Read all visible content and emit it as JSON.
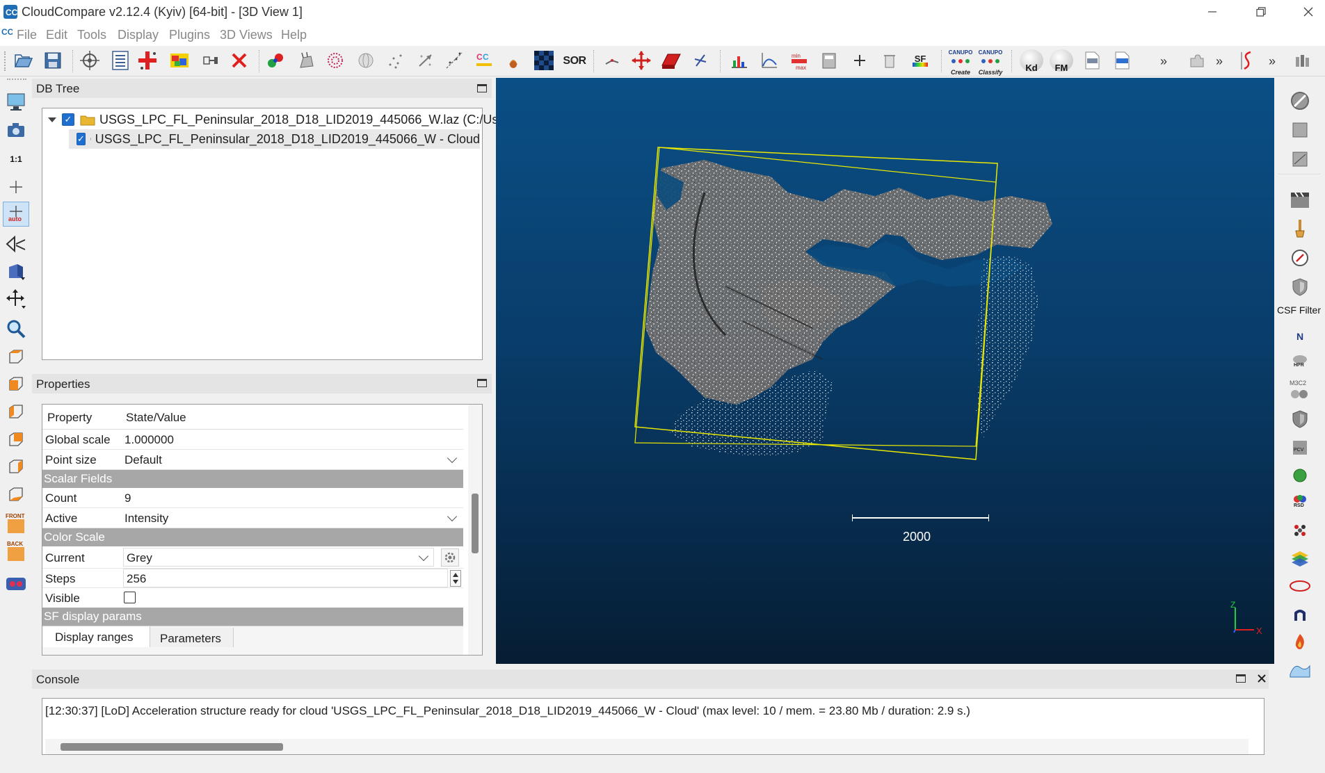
{
  "window": {
    "title": "CloudCompare v2.12.4 (Kyiv) [64-bit] - [3D View 1]"
  },
  "menu": [
    "File",
    "Edit",
    "Tools",
    "Display",
    "Plugins",
    "3D Views",
    "Help"
  ],
  "toolbar": {
    "sor_label": "SOR",
    "sf_label": "SF",
    "canupo_create_top": "CANUPO",
    "canupo_create_bottom": "Create",
    "canupo_classify_top": "CANUPO",
    "canupo_classify_bottom": "Classify",
    "kd_label": "Kd",
    "fm_label": "FM",
    "overflow": "»"
  },
  "left_toolbar": {
    "one_to_one_label": "1:1",
    "auto_label": "auto",
    "front_label": "FRONT",
    "back_label": "BACK"
  },
  "db_tree": {
    "title": "DB Tree",
    "items": [
      {
        "label": "USGS_LPC_FL_Peninsular_2018_D18_LID2019_445066_W.laz (C:/Us...",
        "checked": true
      },
      {
        "label": "USGS_LPC_FL_Peninsular_2018_D18_LID2019_445066_W - Cloud",
        "checked": true
      }
    ]
  },
  "properties": {
    "title": "Properties",
    "header": {
      "property": "Property",
      "value": "State/Value"
    },
    "global_scale": {
      "key": "Global scale",
      "value": "1.000000"
    },
    "point_size": {
      "key": "Point size",
      "value": "Default"
    },
    "scalar_fields_section": "Scalar Fields",
    "count": {
      "key": "Count",
      "value": "9"
    },
    "active": {
      "key": "Active",
      "value": "Intensity"
    },
    "color_scale_section": "Color Scale",
    "current": {
      "key": "Current",
      "value": "Grey"
    },
    "steps": {
      "key": "Steps",
      "value": "256"
    },
    "visible": {
      "key": "Visible",
      "checked": false
    },
    "sf_display_section": "SF display params",
    "tabs": [
      "Display ranges",
      "Parameters"
    ]
  },
  "view3d": {
    "scale_label": "2000",
    "axis_z": "Z",
    "axis_x": "X",
    "bbox_color": "#e8e800"
  },
  "right_toolbar": {
    "csf_label": "CSF Filter",
    "n_label": "N",
    "hpr_label": "HPR",
    "m3c2_label": "M3C2",
    "pcv_label": "PCV",
    "rsd_label": "RSD"
  },
  "console": {
    "title": "Console",
    "message": "[12:30:37] [LoD] Acceleration structure ready for cloud 'USGS_LPC_FL_Peninsular_2018_D18_LID2019_445066_W - Cloud' (max level: 10 / mem. = 23.80 Mb / duration: 2.9 s.)"
  }
}
